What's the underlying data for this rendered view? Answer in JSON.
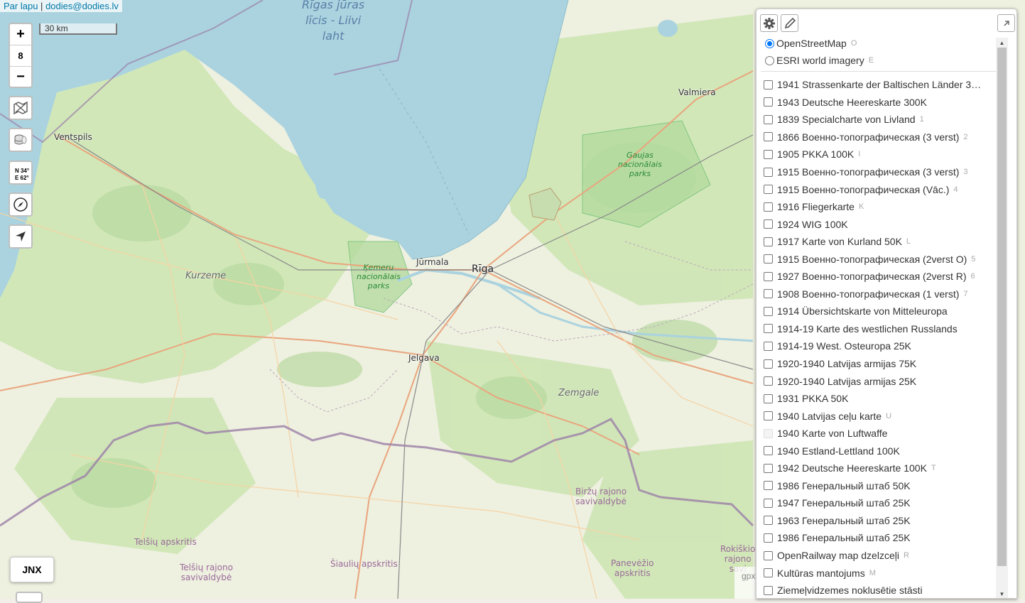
{
  "attribution": {
    "about_link": "Par lapu",
    "separator": "|",
    "email_link": "dodies@dodies.lv"
  },
  "scale": {
    "label": "30 km"
  },
  "zoom": {
    "plus": "+",
    "level": "8",
    "minus": "−"
  },
  "tools": {
    "coords": {
      "lat": "N 34°",
      "lon": "E 62°"
    },
    "icons": [
      "map-layers-icon",
      "coins-icon",
      "compass-icon",
      "locate-arrow-icon"
    ]
  },
  "jnx_button": "JNX",
  "gpx_label": "gpx",
  "map_labels": {
    "sea": "Rīgas jūras\nlīcis - Liivi\nlaht",
    "ventspils": "Ventspils",
    "valmiera": "Valmiera",
    "jurmala": "Jūrmala",
    "riga": "Rīga",
    "jelgava": "Jelgava",
    "kurzeme": "Kurzeme",
    "zemgale": "Zemgale",
    "gauja_park": "Gaujas\nnacionālais\nparks",
    "kemeru_park": "Ķemeru\nnacionālais\nparks",
    "birzu": "Biržų rajono\nsavivaldybė",
    "telsiu_apskritis": "Telšių apskritis",
    "telsiu_rajono": "Telšių rajono\nsavivaldybė",
    "siauliu": "Šiaulių apskritis",
    "panevezio": "Panevėžio\napskritis",
    "rokiskio": "Rokiškio\nrajono\nsavi"
  },
  "layers_panel": {
    "base_layers": [
      {
        "label": "OpenStreetMap",
        "hotkey": "O",
        "selected": true
      },
      {
        "label": "ESRI world imagery",
        "hotkey": "E",
        "selected": false
      }
    ],
    "overlays": [
      {
        "label": "1941 Strassenkarte der Baltischen Länder 3…",
        "hotkey": ""
      },
      {
        "label": "1943 Deutsche Heereskarte 300K",
        "hotkey": ""
      },
      {
        "label": "1839 Specialcharte von Livland",
        "hotkey": "1"
      },
      {
        "label": "1866 Военно-топографическая (3 verst)",
        "hotkey": "2"
      },
      {
        "label": "1905 PKKA 100K",
        "hotkey": "I"
      },
      {
        "label": "1915 Военно-топографическая (3 verst)",
        "hotkey": "3"
      },
      {
        "label": "1915 Военно-топографическая (Vāc.)",
        "hotkey": "4"
      },
      {
        "label": "1916 Fliegerkarte",
        "hotkey": "K"
      },
      {
        "label": "1924 WIG 100K",
        "hotkey": ""
      },
      {
        "label": "1917 Karte von Kurland 50K",
        "hotkey": "L"
      },
      {
        "label": "1915 Военно-топографическая (2verst O)",
        "hotkey": "5"
      },
      {
        "label": "1927 Военно-топографическая (2verst R)",
        "hotkey": "6"
      },
      {
        "label": "1908 Военно-топографическая (1 verst)",
        "hotkey": "7"
      },
      {
        "label": "1914 Übersichtskarte von Mitteleuropa",
        "hotkey": ""
      },
      {
        "label": "1914-19 Karte des westlichen Russlands",
        "hotkey": ""
      },
      {
        "label": "1914-19 West. Osteuropa 25K",
        "hotkey": ""
      },
      {
        "label": "1920-1940 Latvijas armijas 75K",
        "hotkey": ""
      },
      {
        "label": "1920-1940 Latvijas armijas 25K",
        "hotkey": ""
      },
      {
        "label": "1931 PKKA 50K",
        "hotkey": ""
      },
      {
        "label": "1940 Latvijas ceļu karte",
        "hotkey": "U"
      },
      {
        "label": "1940 Karte von Luftwaffe",
        "hotkey": "",
        "disabled": true
      },
      {
        "label": "1940 Estland-Lettland 100K",
        "hotkey": ""
      },
      {
        "label": "1942 Deutsche Heereskarte 100K",
        "hotkey": "T"
      },
      {
        "label": "1986 Генеральный штаб 50K",
        "hotkey": ""
      },
      {
        "label": "1947 Генеральный штаб 25K",
        "hotkey": ""
      },
      {
        "label": "1963 Генеральный штаб 25K",
        "hotkey": ""
      },
      {
        "label": "1986 Генеральный штаб 25K",
        "hotkey": ""
      },
      {
        "label": "OpenRailway map dzelzceļi",
        "hotkey": "R"
      },
      {
        "label": "Kultūras mantojums",
        "hotkey": "M"
      },
      {
        "label": "Ziemeļvidzemes noklusētie stāsti",
        "hotkey": ""
      }
    ]
  }
}
